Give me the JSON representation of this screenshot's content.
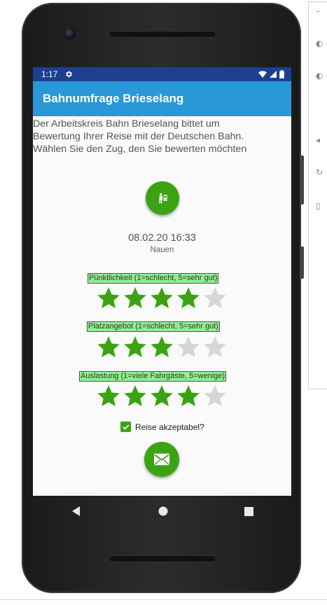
{
  "status_bar": {
    "time": "1:17"
  },
  "app_bar": {
    "title": "Bahnumfrage Brieselang"
  },
  "intro": {
    "line1": "Der Arbeitskreis Bahn Brieselang bittet um",
    "line2": "Bewertung Ihrer Reise mit der Deutschen Bahn.",
    "line3": "Wählen Sie den Zug, den Sie bewerten möchten"
  },
  "trip": {
    "datetime": "08.02.20 16:33",
    "station": "Nauen"
  },
  "ratings": [
    {
      "label": "Pünktlichkeit (1=schlecht, 5=sehr gut)",
      "value": 4,
      "max": 5
    },
    {
      "label": "Platzangebot (1=schlecht, 5=sehr gut)",
      "value": 3,
      "max": 5
    },
    {
      "label": "Auslastung (1=viele Fahrgäste, 5=wenige)",
      "value": 4,
      "max": 5
    }
  ],
  "checkbox": {
    "label": "Reise akzeptabel?",
    "checked": true
  },
  "colors": {
    "accent_green": "#3ba313",
    "app_bar": "#2898d8",
    "status_bar": "#1c3f8f",
    "star_empty": "#d6d6d6"
  },
  "icons": {
    "train_button": "train-select-icon",
    "send_button": "mail-icon",
    "status_settings": "gear-icon"
  }
}
